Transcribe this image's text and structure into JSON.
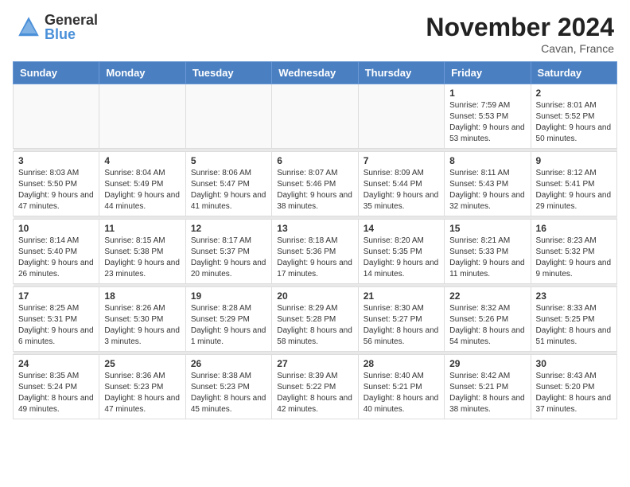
{
  "header": {
    "logo_general": "General",
    "logo_blue": "Blue",
    "month_year": "November 2024",
    "location": "Cavan, France"
  },
  "days_of_week": [
    "Sunday",
    "Monday",
    "Tuesday",
    "Wednesday",
    "Thursday",
    "Friday",
    "Saturday"
  ],
  "weeks": [
    [
      {
        "day": "",
        "info": ""
      },
      {
        "day": "",
        "info": ""
      },
      {
        "day": "",
        "info": ""
      },
      {
        "day": "",
        "info": ""
      },
      {
        "day": "",
        "info": ""
      },
      {
        "day": "1",
        "info": "Sunrise: 7:59 AM\nSunset: 5:53 PM\nDaylight: 9 hours and 53 minutes."
      },
      {
        "day": "2",
        "info": "Sunrise: 8:01 AM\nSunset: 5:52 PM\nDaylight: 9 hours and 50 minutes."
      }
    ],
    [
      {
        "day": "3",
        "info": "Sunrise: 8:03 AM\nSunset: 5:50 PM\nDaylight: 9 hours and 47 minutes."
      },
      {
        "day": "4",
        "info": "Sunrise: 8:04 AM\nSunset: 5:49 PM\nDaylight: 9 hours and 44 minutes."
      },
      {
        "day": "5",
        "info": "Sunrise: 8:06 AM\nSunset: 5:47 PM\nDaylight: 9 hours and 41 minutes."
      },
      {
        "day": "6",
        "info": "Sunrise: 8:07 AM\nSunset: 5:46 PM\nDaylight: 9 hours and 38 minutes."
      },
      {
        "day": "7",
        "info": "Sunrise: 8:09 AM\nSunset: 5:44 PM\nDaylight: 9 hours and 35 minutes."
      },
      {
        "day": "8",
        "info": "Sunrise: 8:11 AM\nSunset: 5:43 PM\nDaylight: 9 hours and 32 minutes."
      },
      {
        "day": "9",
        "info": "Sunrise: 8:12 AM\nSunset: 5:41 PM\nDaylight: 9 hours and 29 minutes."
      }
    ],
    [
      {
        "day": "10",
        "info": "Sunrise: 8:14 AM\nSunset: 5:40 PM\nDaylight: 9 hours and 26 minutes."
      },
      {
        "day": "11",
        "info": "Sunrise: 8:15 AM\nSunset: 5:38 PM\nDaylight: 9 hours and 23 minutes."
      },
      {
        "day": "12",
        "info": "Sunrise: 8:17 AM\nSunset: 5:37 PM\nDaylight: 9 hours and 20 minutes."
      },
      {
        "day": "13",
        "info": "Sunrise: 8:18 AM\nSunset: 5:36 PM\nDaylight: 9 hours and 17 minutes."
      },
      {
        "day": "14",
        "info": "Sunrise: 8:20 AM\nSunset: 5:35 PM\nDaylight: 9 hours and 14 minutes."
      },
      {
        "day": "15",
        "info": "Sunrise: 8:21 AM\nSunset: 5:33 PM\nDaylight: 9 hours and 11 minutes."
      },
      {
        "day": "16",
        "info": "Sunrise: 8:23 AM\nSunset: 5:32 PM\nDaylight: 9 hours and 9 minutes."
      }
    ],
    [
      {
        "day": "17",
        "info": "Sunrise: 8:25 AM\nSunset: 5:31 PM\nDaylight: 9 hours and 6 minutes."
      },
      {
        "day": "18",
        "info": "Sunrise: 8:26 AM\nSunset: 5:30 PM\nDaylight: 9 hours and 3 minutes."
      },
      {
        "day": "19",
        "info": "Sunrise: 8:28 AM\nSunset: 5:29 PM\nDaylight: 9 hours and 1 minute."
      },
      {
        "day": "20",
        "info": "Sunrise: 8:29 AM\nSunset: 5:28 PM\nDaylight: 8 hours and 58 minutes."
      },
      {
        "day": "21",
        "info": "Sunrise: 8:30 AM\nSunset: 5:27 PM\nDaylight: 8 hours and 56 minutes."
      },
      {
        "day": "22",
        "info": "Sunrise: 8:32 AM\nSunset: 5:26 PM\nDaylight: 8 hours and 54 minutes."
      },
      {
        "day": "23",
        "info": "Sunrise: 8:33 AM\nSunset: 5:25 PM\nDaylight: 8 hours and 51 minutes."
      }
    ],
    [
      {
        "day": "24",
        "info": "Sunrise: 8:35 AM\nSunset: 5:24 PM\nDaylight: 8 hours and 49 minutes."
      },
      {
        "day": "25",
        "info": "Sunrise: 8:36 AM\nSunset: 5:23 PM\nDaylight: 8 hours and 47 minutes."
      },
      {
        "day": "26",
        "info": "Sunrise: 8:38 AM\nSunset: 5:23 PM\nDaylight: 8 hours and 45 minutes."
      },
      {
        "day": "27",
        "info": "Sunrise: 8:39 AM\nSunset: 5:22 PM\nDaylight: 8 hours and 42 minutes."
      },
      {
        "day": "28",
        "info": "Sunrise: 8:40 AM\nSunset: 5:21 PM\nDaylight: 8 hours and 40 minutes."
      },
      {
        "day": "29",
        "info": "Sunrise: 8:42 AM\nSunset: 5:21 PM\nDaylight: 8 hours and 38 minutes."
      },
      {
        "day": "30",
        "info": "Sunrise: 8:43 AM\nSunset: 5:20 PM\nDaylight: 8 hours and 37 minutes."
      }
    ]
  ]
}
